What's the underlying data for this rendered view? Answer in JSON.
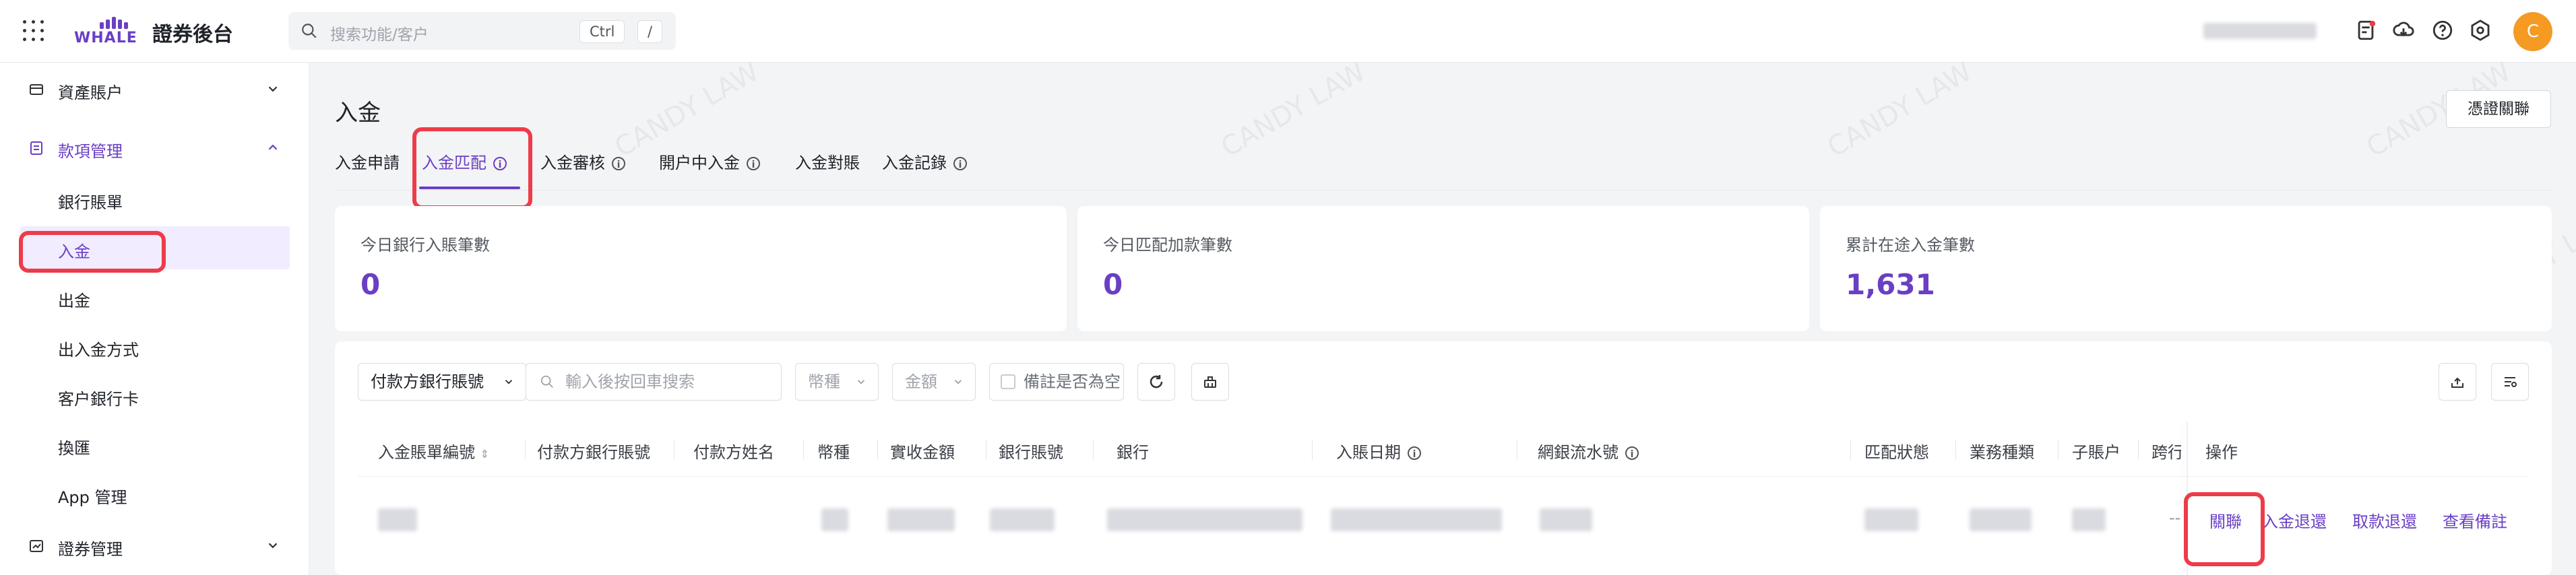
{
  "app": {
    "brand_name": "證券後台",
    "logo_word": "WHALE"
  },
  "search": {
    "placeholder": "搜索功能/客户",
    "shortcut_key1": "Ctrl",
    "shortcut_key2": "/"
  },
  "user": {
    "avatar_letter": "C"
  },
  "colors": {
    "accent": "#6a3fc4",
    "highlight": "#ee3b4a",
    "avatar": "#f59a23"
  },
  "sidebar": {
    "groups": [
      {
        "label": "資產賬户",
        "icon": "wallet-icon",
        "expanded": false
      },
      {
        "label": "款項管理",
        "icon": "ledger-icon",
        "expanded": true,
        "items": [
          "銀行賬單",
          "入金",
          "出金",
          "出入金方式",
          "客户銀行卡",
          "換匯",
          "App 管理"
        ]
      },
      {
        "label": "證券管理",
        "icon": "chart-icon",
        "expanded": false
      }
    ],
    "active_item": "入金"
  },
  "page": {
    "title": "入金",
    "action_button": "憑證關聯",
    "tabs": [
      "入金申請",
      "入金匹配",
      "入金審核",
      "開户中入金",
      "入金對賬",
      "入金記錄"
    ],
    "active_tab": "入金匹配"
  },
  "stats": [
    {
      "label": "今日銀行入賬筆數",
      "value": "0"
    },
    {
      "label": "今日匹配加款筆數",
      "value": "0"
    },
    {
      "label": "累計在途入金筆數",
      "value": "1,631"
    }
  ],
  "filters": {
    "account_select": "付款方銀行賬號",
    "search_placeholder": "輸入後按回車搜索",
    "currency_placeholder": "幣種",
    "amount_placeholder": "金額",
    "remark_checkbox": "備註是否為空"
  },
  "table": {
    "columns": [
      "入金賬單編號",
      "付款方銀行賬號",
      "付款方姓名",
      "幣種",
      "實收金額",
      "銀行賬號",
      "銀行",
      "入賬日期",
      "網銀流水號",
      "匹配狀態",
      "業務種類",
      "子賬户",
      "跨行",
      "操作"
    ],
    "row_actions": [
      "關聯",
      "入金退還",
      "取款退還",
      "查看備註"
    ],
    "row_placeholder": "--"
  },
  "watermark": "CANDY LAW"
}
